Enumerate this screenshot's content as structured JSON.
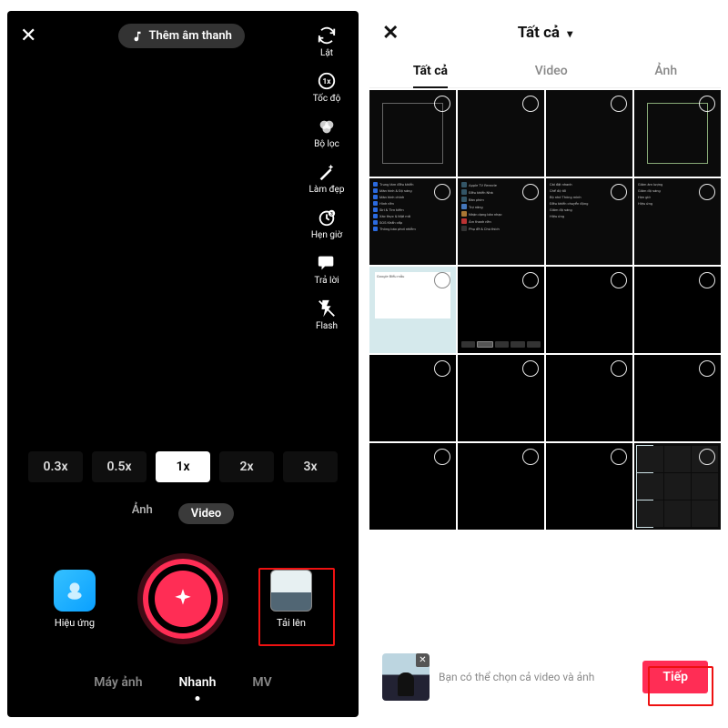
{
  "left": {
    "add_sound_label": "Thêm âm thanh",
    "tools": {
      "flip": "Lật",
      "speed": "Tốc độ",
      "filter": "Bộ lọc",
      "beauty": "Làm đẹp",
      "timer": "Hẹn giờ",
      "reply": "Trả lời",
      "flash": "Flash"
    },
    "speeds": [
      "0.3x",
      "0.5x",
      "1x",
      "2x",
      "3x"
    ],
    "media_tabs": {
      "photo": "Ảnh",
      "video": "Video"
    },
    "capture": {
      "effects": "Hiệu ứng",
      "upload": "Tải lên"
    },
    "modes": {
      "camera": "Máy ảnh",
      "quick": "Nhanh",
      "mv": "MV"
    }
  },
  "right": {
    "title": "Tất cả",
    "tabs": {
      "all": "Tất cả",
      "video": "Video",
      "photo": "Ảnh"
    },
    "hint": "Bạn có thể chọn cả video và ảnh",
    "next": "Tiếp"
  }
}
